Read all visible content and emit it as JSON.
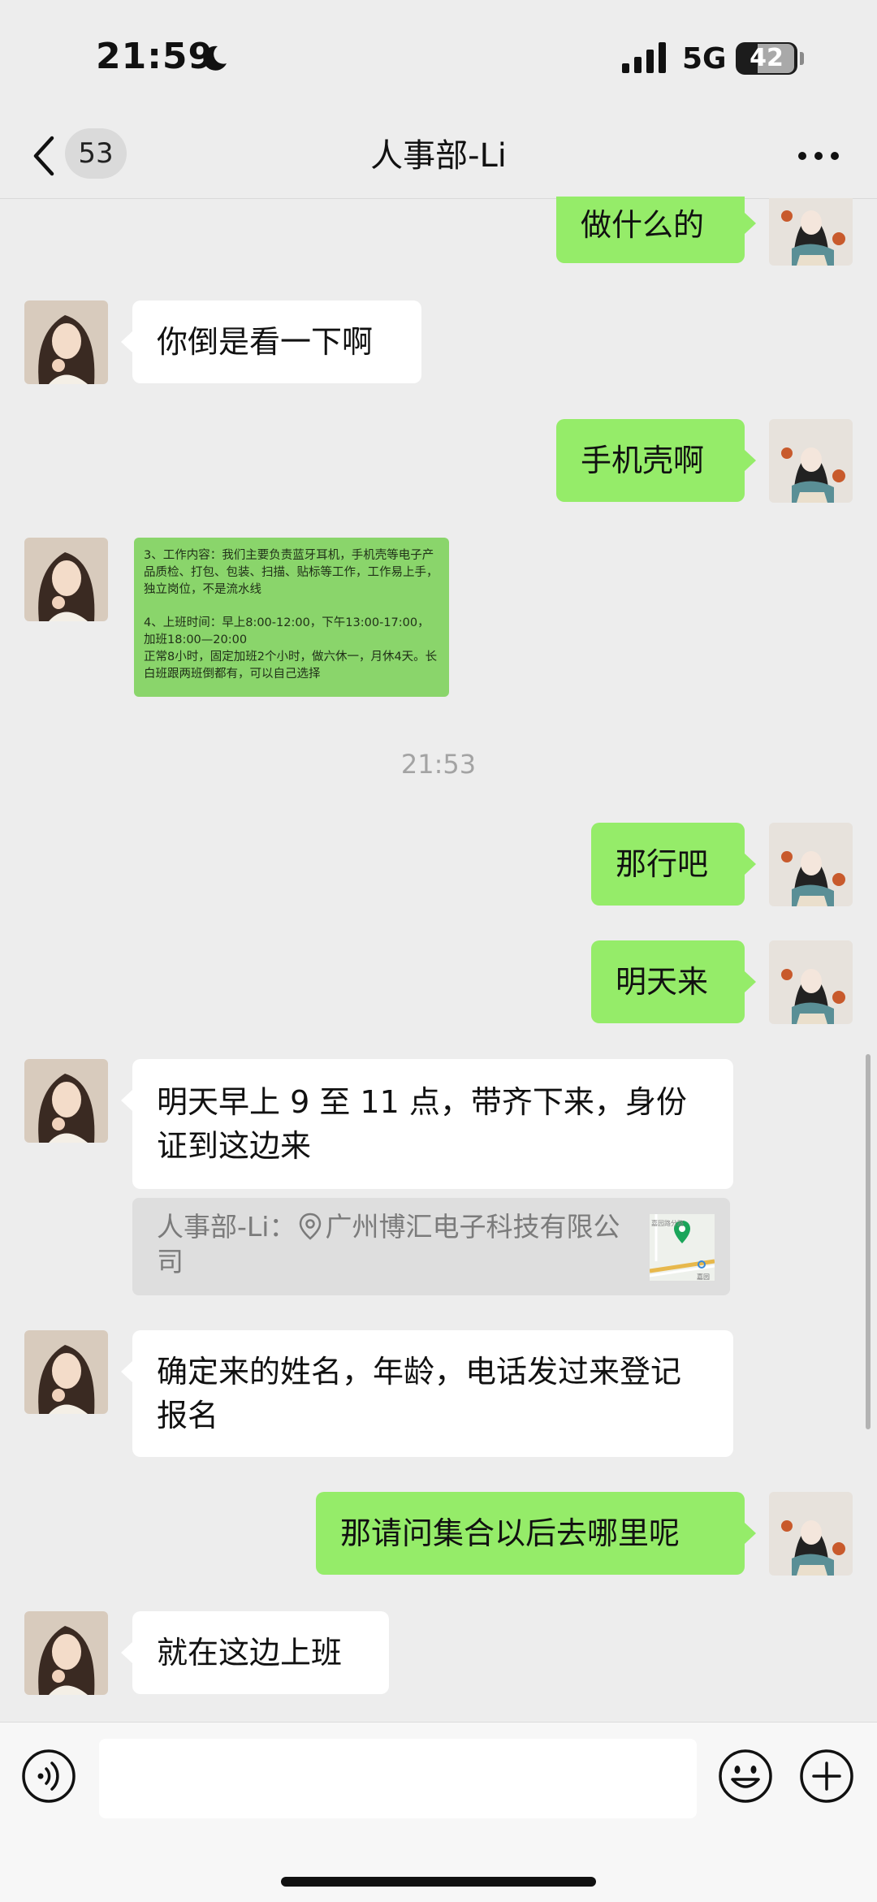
{
  "status_bar": {
    "time": "21:59",
    "network": "5G",
    "battery": "42"
  },
  "header": {
    "back_count": "53",
    "title": "人事部-Li"
  },
  "messages": [
    {
      "dir": "out",
      "text": "做什么的"
    },
    {
      "dir": "in",
      "text": "你倒是看一下啊"
    },
    {
      "dir": "out",
      "text": "手机壳啊"
    },
    {
      "dir": "in",
      "type": "image"
    },
    {
      "dir": "out",
      "text": "那行吧"
    },
    {
      "dir": "out",
      "text": "明天来"
    },
    {
      "dir": "in",
      "text": "明天早上 9 至 11 点，带齐下来，身份证到这边来"
    },
    {
      "dir": "in",
      "text": "确定来的姓名，年龄，电话发过来登记报名"
    },
    {
      "dir": "out",
      "text": "那请问集合以后去哪里呢"
    },
    {
      "dir": "in",
      "text": "就在这边上班"
    }
  ],
  "image_message": {
    "para1": "3、工作内容：我们主要负责蓝牙耳机，手机壳等电子产品质检、打包、包装、扫描、贴标等工作，工作易上手，独立岗位，不是流水线",
    "para2_line1": "4、上班时间：早上8:00-12:00，下午13:00-17:00，加班18:00—20:00",
    "para2_line2": "正常8小时，固定加班2个小时，做六休一，月休4天。长白班跟两班倒都有，可以自己选择"
  },
  "timestamp": "21:53",
  "quote": {
    "sender": "人事部-Li：",
    "location": "广州博汇电子科技有限公司"
  },
  "map_labels": {
    "road": "嘉园路分路",
    "place": "嘉园"
  },
  "icons": {
    "voice": "voice-icon",
    "emoji": "emoji-icon",
    "plus": "plus-icon",
    "back": "chevron-left-icon",
    "more": "more-icon"
  },
  "colors": {
    "outgoing": "#95ec69",
    "incoming": "#ffffff",
    "background": "#ededed"
  }
}
